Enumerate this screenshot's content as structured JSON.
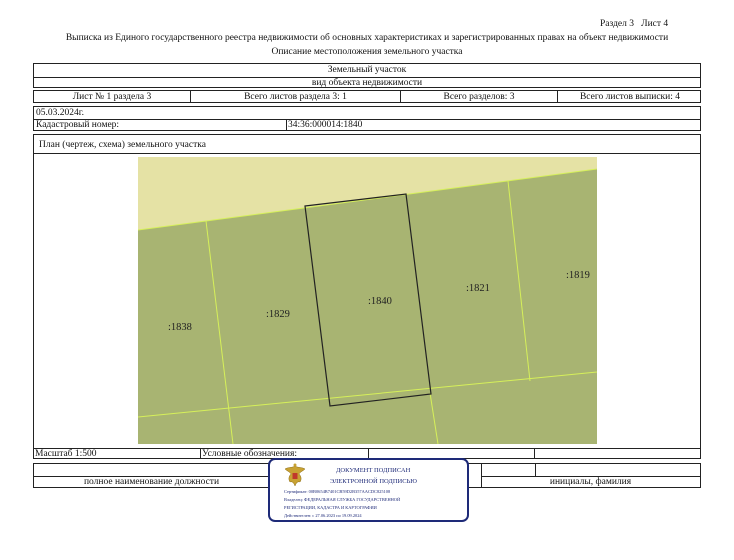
{
  "header": {
    "section_sheet": "Раздел 3   Лист 4",
    "title": "Выписка из Единого государственного реестра недвижимости об основных характеристиках и зарегистрированных правах на объект недвижимости",
    "subtitle": "Описание местоположения земельного участка"
  },
  "object": {
    "name": "Земельный участок",
    "caption": "вид объекта недвижимости"
  },
  "sheet_info": {
    "sheet": "Лист № 1 раздела 3",
    "total_section_sheets": "Всего листов раздела 3: 1",
    "total_sections": "Всего разделов: 3",
    "total_extract_sheets": "Всего листов выписки: 4"
  },
  "date": "05.03.2024г.",
  "cadastral": {
    "label": "Кадастровый номер:",
    "value": "34:36:000014:1840"
  },
  "plan": {
    "title": "План (чертеж, схема) земельного участка",
    "parcels": [
      ":1838",
      ":1829",
      ":1840",
      ":1821",
      ":1819"
    ],
    "colors": {
      "neighbor_fill": "#a8b472",
      "road_fill": "#e5e2a5",
      "boundary_line": "#d6f05a",
      "subject_outline": "#222222"
    }
  },
  "scale": {
    "label": "Масштаб 1:500",
    "legend": "Условные обозначения:"
  },
  "signature_row": {
    "position": "полное наименование должности",
    "initials": "инициалы, фамилия"
  },
  "stamp": {
    "line1": "ДОКУМЕНТ ПОДПИСАН",
    "line2": "ЭЛЕКТРОННОЙ ПОДПИСЬЮ",
    "certificate": "Сертификат: 00B0654B7401CB59D2B357AACDC825108",
    "owner1": "Владелец: ФЕДЕРАЛЬНАЯ СЛУЖБА ГОСУДАРСТВЕННОЙ",
    "owner2": "РЕГИСТРАЦИИ, КАДАСТРА И КАРТОГРАФИИ",
    "validity": "Действителен: с 27.06.2023 по 19.09.2024",
    "emblem_icon": "double-headed-eagle-emblem"
  }
}
